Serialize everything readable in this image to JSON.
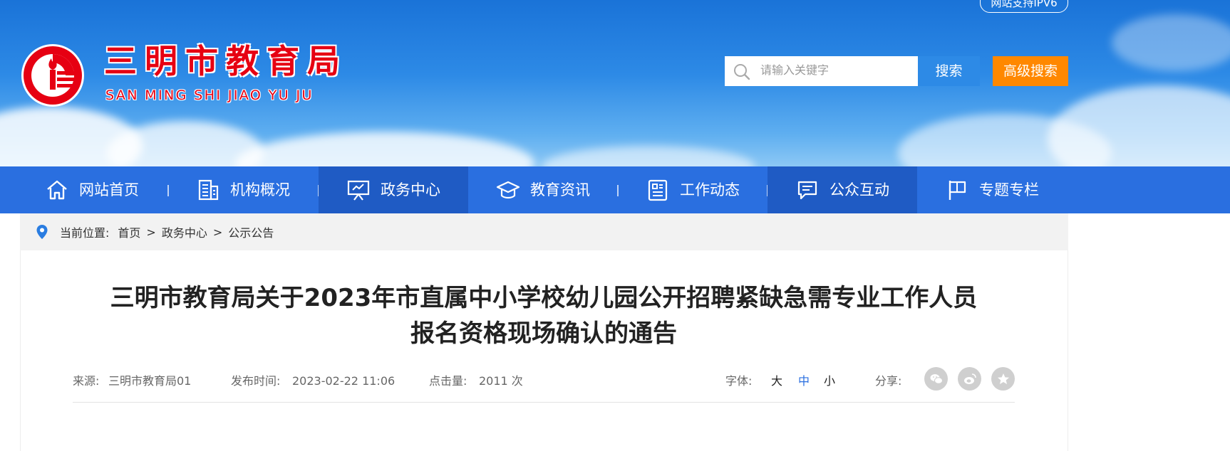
{
  "header": {
    "ipv6_badge": "网站支持IPV6",
    "site_name": "三明市教育局",
    "site_pinyin": "SAN MING SHI JIAO YU JU",
    "search_placeholder": "请输入关键字",
    "search_button": "搜索",
    "advanced_search_button": "高级搜索",
    "colors": {
      "brand_red": "#e60012",
      "search_blue": "#2d8ae6",
      "advanced_orange": "#ff8800"
    }
  },
  "nav": {
    "items": [
      {
        "label": "网站首页",
        "icon": "home-icon"
      },
      {
        "label": "机构概况",
        "icon": "building-icon"
      },
      {
        "label": "政务中心",
        "icon": "presentation-icon",
        "active": true
      },
      {
        "label": "教育资讯",
        "icon": "graduation-cap-icon"
      },
      {
        "label": "工作动态",
        "icon": "newspaper-icon"
      },
      {
        "label": "公众互动",
        "icon": "chat-icon",
        "active": true
      },
      {
        "label": "专题专栏",
        "icon": "flag-icon"
      }
    ],
    "color": "#2a6fe0"
  },
  "breadcrumb": {
    "label": "当前位置:",
    "items": [
      "首页",
      "政务中心",
      "公示公告"
    ],
    "separator": ">"
  },
  "article": {
    "title_line1": "三明市教育局关于2023年市直属中小学校幼儿园公开招聘紧缺急需专业工作人员",
    "title_line2": "报名资格现场确认的通告",
    "source_label": "来源:",
    "source": "三明市教育局01",
    "publish_label": "发布时间:",
    "publish_time": "2023-02-22 11:06",
    "views_label": "点击量:",
    "views": "2011 次",
    "font_label": "字体:",
    "font_sizes": [
      "大",
      "中",
      "小"
    ],
    "share_label": "分享:",
    "share_icons": [
      "wechat-icon",
      "weibo-icon",
      "favorite-star-icon"
    ]
  }
}
